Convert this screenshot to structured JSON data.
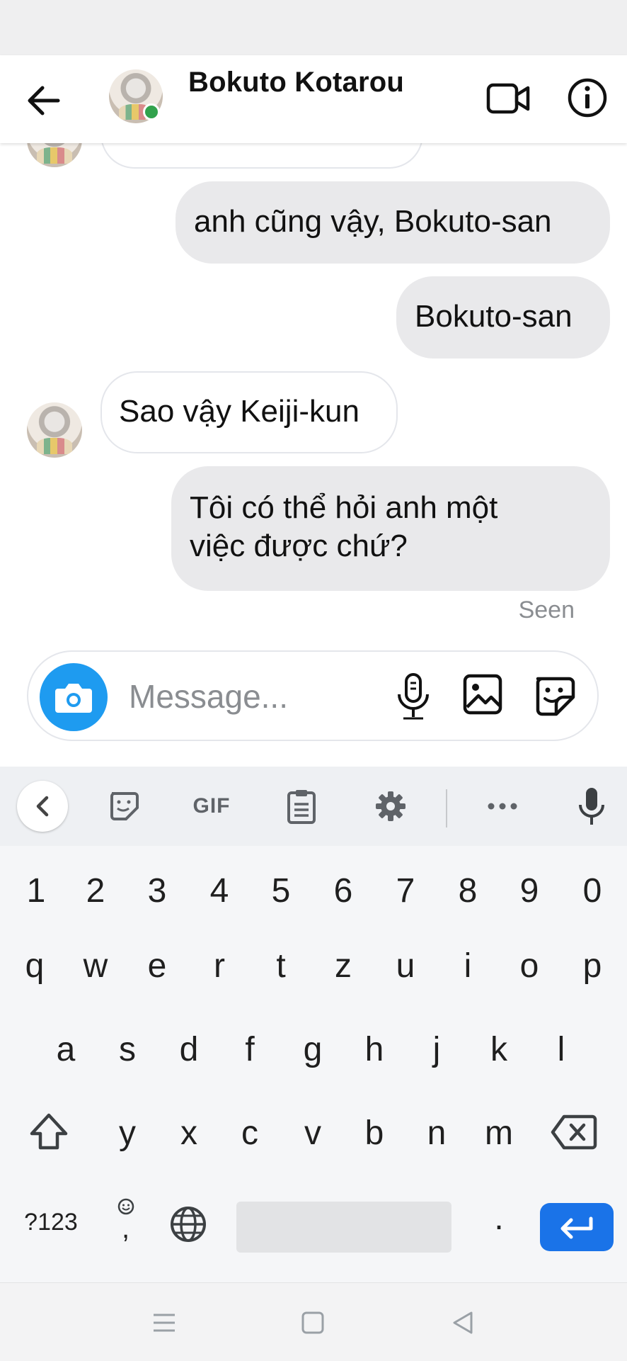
{
  "header": {
    "contact_name": "Bokuto Kotarou"
  },
  "messages": [
    {
      "direction": "outgoing",
      "text": "anh cũng vậy, Bokuto-san"
    },
    {
      "direction": "outgoing",
      "text": "Bokuto-san"
    },
    {
      "direction": "incoming",
      "text": "Sao vậy Keiji-kun"
    },
    {
      "direction": "outgoing",
      "lines": [
        "Tôi có thể hỏi anh một",
        "việc được chứ?"
      ]
    }
  ],
  "seen_label": "Seen",
  "composer": {
    "placeholder": "Message..."
  },
  "keyboard": {
    "toolbar_gif": "GIF",
    "row_numbers": [
      "1",
      "2",
      "3",
      "4",
      "5",
      "6",
      "7",
      "8",
      "9",
      "0"
    ],
    "row_1": [
      "q",
      "w",
      "e",
      "r",
      "t",
      "z",
      "u",
      "i",
      "o",
      "p"
    ],
    "row_2": [
      "a",
      "s",
      "d",
      "f",
      "g",
      "h",
      "j",
      "k",
      "l"
    ],
    "row_3": [
      "y",
      "x",
      "c",
      "v",
      "b",
      "n",
      "m"
    ],
    "symbols_key": "?123",
    "comma_key": ",",
    "period_key": "."
  },
  "colors": {
    "accent": "#1a73e8",
    "online": "#31a24c",
    "camera": "#1e9bf0"
  }
}
